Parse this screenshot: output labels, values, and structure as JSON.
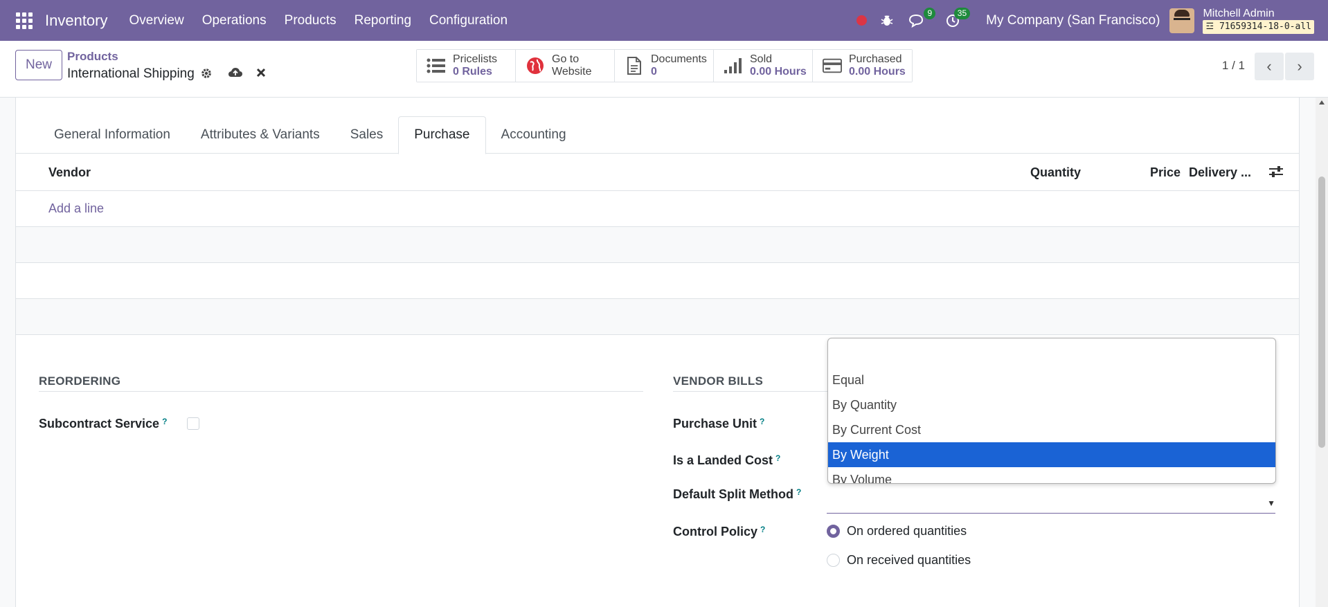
{
  "navbar": {
    "app_name": "Inventory",
    "menu": [
      "Overview",
      "Operations",
      "Products",
      "Reporting",
      "Configuration"
    ],
    "messages_badge": "9",
    "activities_badge": "35",
    "company": "My Company (San Francisco)",
    "user_name": "Mitchell Admin",
    "db_name": "71659314-18-0-all"
  },
  "control_panel": {
    "new_label": "New",
    "breadcrumb_parent": "Products",
    "record_title": "International Shipping",
    "pager": "1 / 1",
    "smart_buttons": [
      {
        "label": "Pricelists",
        "value": "0 Rules",
        "icon": "list-icon"
      },
      {
        "label": "Go to",
        "value": "Website",
        "icon": "globe-icon"
      },
      {
        "label": "Documents",
        "value": "0",
        "icon": "document-icon"
      },
      {
        "label": "Sold",
        "value": "0.00 Hours",
        "icon": "bar-chart-icon"
      },
      {
        "label": "Purchased",
        "value": "0.00 Hours",
        "icon": "credit-card-icon"
      }
    ]
  },
  "tabs": [
    "General Information",
    "Attributes & Variants",
    "Sales",
    "Purchase",
    "Accounting"
  ],
  "active_tab": "Purchase",
  "vendor_table": {
    "headers": {
      "vendor": "Vendor",
      "quantity": "Quantity",
      "price": "Price",
      "delivery": "Delivery ..."
    },
    "add_line": "Add a line"
  },
  "reordering": {
    "title": "REORDERING",
    "subcontract_label": "Subcontract Service",
    "subcontract_checked": false
  },
  "vendor_bills": {
    "title": "VENDOR BILLS",
    "purchase_unit_label": "Purchase Unit",
    "landed_cost_label": "Is a Landed Cost",
    "split_method_label": "Default Split Method",
    "control_policy_label": "Control Policy",
    "control_policy_options": [
      "On ordered quantities",
      "On received quantities"
    ],
    "control_policy_selected": "On ordered quantities"
  },
  "help_mark": "?",
  "split_dropdown": {
    "options": [
      "",
      "Equal",
      "By Quantity",
      "By Current Cost",
      "By Weight",
      "By Volume"
    ],
    "highlighted": "By Weight"
  },
  "colors": {
    "brand": "#71639e",
    "highlight": "#1a63d5",
    "badge": "#1e8a3c",
    "record": "#dc3545"
  }
}
